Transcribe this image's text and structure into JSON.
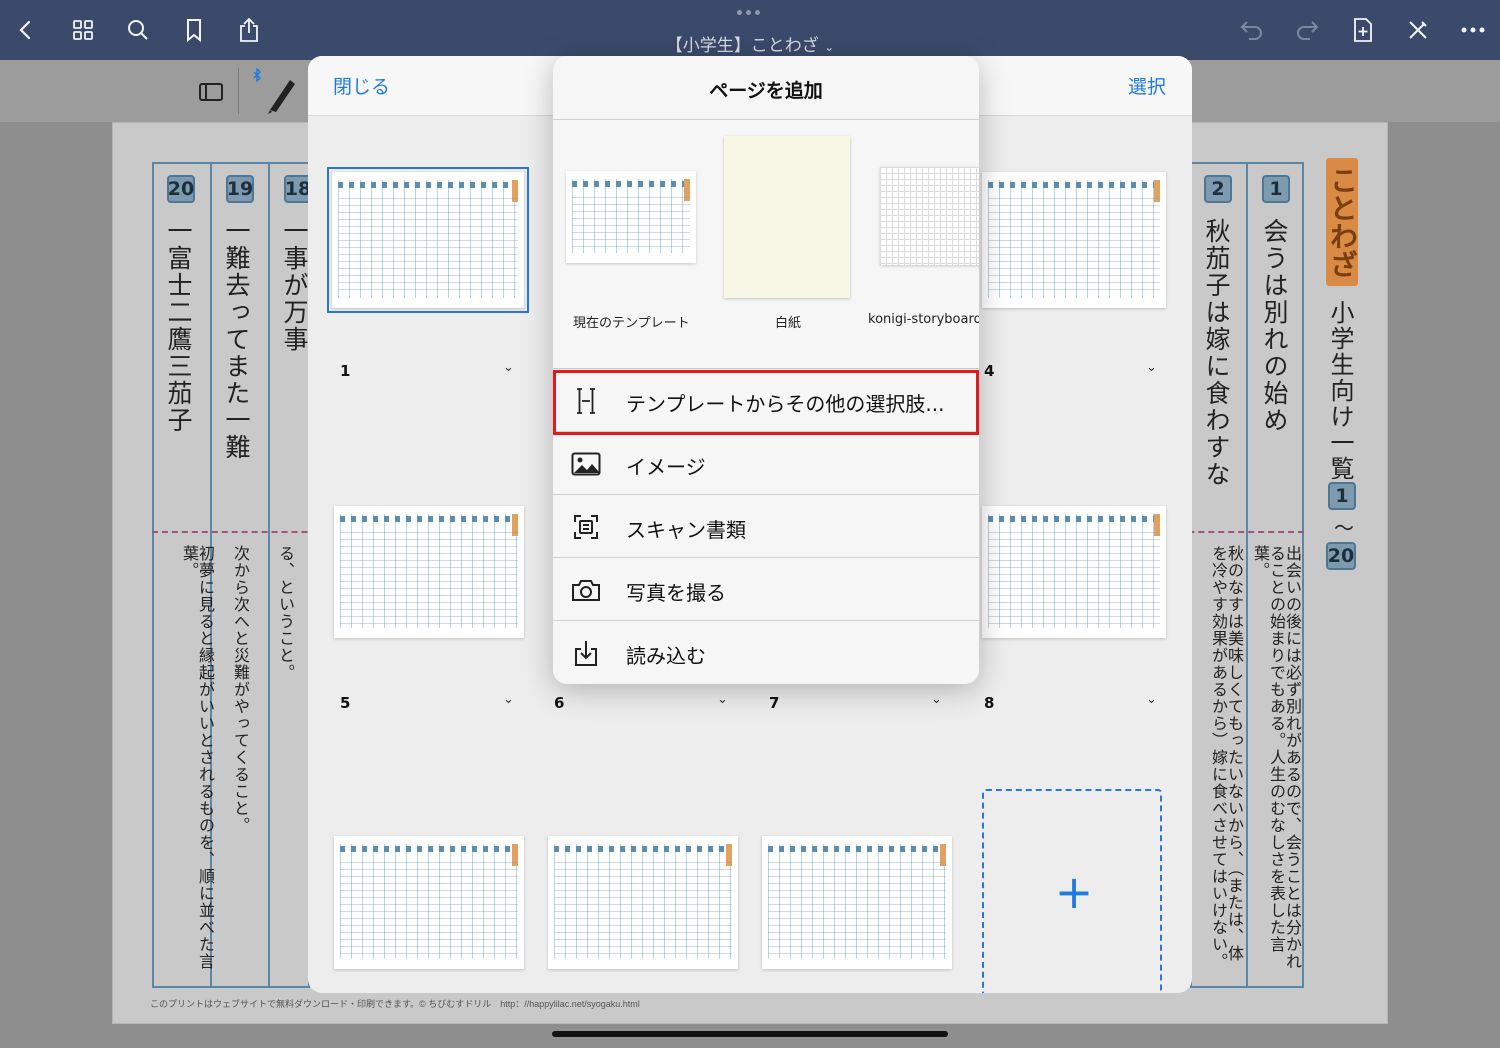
{
  "topbar": {
    "title": "【小学生】ことわざ",
    "title_chevron": "⌄",
    "icons_left": [
      "back-icon",
      "grid-icon",
      "search-icon",
      "bookmark-icon",
      "share-icon"
    ],
    "icons_right": [
      "undo-icon",
      "redo-icon",
      "add-page-icon",
      "pen-off-icon",
      "more-icon"
    ]
  },
  "document": {
    "columns": [
      {
        "num": "20",
        "main": "一富士二鷹三茄子",
        "desc": "初夢に見ると縁起がいいとされるものを、順に並べた言葉。"
      },
      {
        "num": "19",
        "main": "一難去ってまた一難",
        "desc": "次から次へと災難がやってくること。"
      },
      {
        "num": "18",
        "main": "一事が万事",
        "desc": "る、ということ。"
      },
      {
        "num": "2",
        "main": "秋茄子は嫁に食わすな",
        "desc": "秋のなすは美味しくてもったいないから、（または、体を冷やす効果があるから）嫁に食べさせてはいけない。"
      },
      {
        "num": "1",
        "main": "会うは別れの始め",
        "desc": "出会いの後には必ず別れがあるので、会うことは分かれることの始まりでもある。人生のむなしさを表した言葉。"
      }
    ],
    "side_label": "ことわざ",
    "side_title": "小学生向け一覧",
    "range_from": "1",
    "range_sep": "〜",
    "range_to": "20",
    "footer": "このプリントはウェブサイトで無料ダウンロード・印刷できます。© ちびむすドリル　http：//happylilac.net/syogaku.html"
  },
  "modal": {
    "close_label": "閉じる",
    "select_label": "選択",
    "pages": [
      {
        "label": "1",
        "chevron": "⌄"
      },
      {
        "label": "4",
        "chevron": "⌄"
      },
      {
        "label": "5",
        "chevron": "⌄"
      },
      {
        "label": "6",
        "chevron": "⌄"
      },
      {
        "label": "7",
        "chevron": "⌄"
      },
      {
        "label": "8",
        "chevron": "⌄"
      }
    ],
    "add_symbol": "+"
  },
  "popover": {
    "title": "ページを追加",
    "templates": [
      {
        "name": "現在のテンプレート"
      },
      {
        "name": "白紙"
      },
      {
        "name": "konigi-storyboard"
      }
    ],
    "menu": [
      {
        "icon": "template-options-icon",
        "label": "テンプレートからその他の選択肢..."
      },
      {
        "icon": "image-icon",
        "label": "イメージ"
      },
      {
        "icon": "scan-icon",
        "label": "スキャン書類"
      },
      {
        "icon": "camera-icon",
        "label": "写真を撮る"
      },
      {
        "icon": "import-icon",
        "label": "読み込む"
      }
    ],
    "highlight_color": "#e01b1b"
  },
  "colors": {
    "accent": "#1f7be0",
    "topbar": "#3b4a6b",
    "highlight": "#e01b1b"
  }
}
